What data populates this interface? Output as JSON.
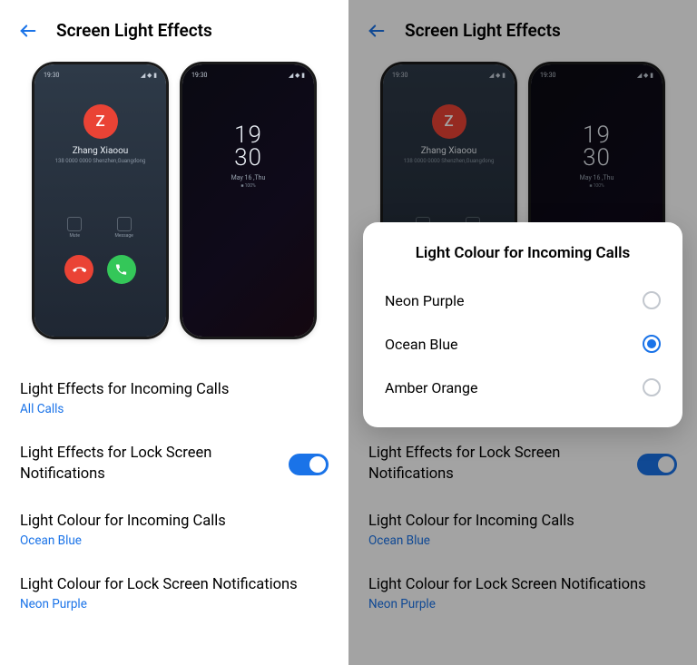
{
  "header": {
    "title": "Screen Light Effects"
  },
  "phone_preview": {
    "status_time": "19:30",
    "caller": {
      "initial": "Z",
      "name": "Zhang Xiaoou",
      "sub": "138 0000 0000  Shenzhen,Guangdong"
    },
    "mute_label": "Mute",
    "message_label": "Message",
    "clock": {
      "time_top": "19",
      "time_bottom": "30",
      "date": "May 16 ,Thu",
      "battery": "■ 100%"
    }
  },
  "settings": {
    "effects_calls": {
      "title": "Light Effects for Incoming Calls",
      "value": "All Calls"
    },
    "effects_lock": {
      "title": "Light Effects for Lock Screen Notifications",
      "toggle": true
    },
    "colour_calls": {
      "title": "Light Colour for Incoming Calls",
      "value": "Ocean Blue"
    },
    "colour_lock": {
      "title": "Light Colour for Lock Screen Notifications",
      "value": "Neon Purple"
    }
  },
  "dialog": {
    "title": "Light Colour for Incoming Calls",
    "options": [
      "Neon Purple",
      "Ocean Blue",
      "Amber Orange"
    ],
    "selected": "Ocean Blue"
  }
}
